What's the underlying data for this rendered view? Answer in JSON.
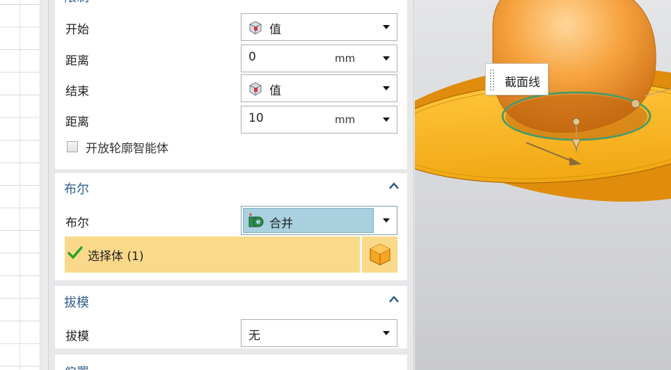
{
  "limit_section": {
    "title_partial": "限制",
    "start_label": "开始",
    "start_value": "值",
    "distance1_label": "距离",
    "distance1_value": "0",
    "distance1_unit": "mm",
    "end_label": "结束",
    "end_value": "值",
    "distance2_label": "距离",
    "distance2_value": "10",
    "distance2_unit": "mm",
    "open_profile_label": "开放轮廓智能体",
    "open_profile_checked": false
  },
  "boolean_section": {
    "title": "布尔",
    "bool_label": "布尔",
    "bool_value": "合并",
    "select_body_label": "选择体 (1)"
  },
  "draft_section": {
    "title": "拔模",
    "draft_label": "拔模",
    "draft_value": "无"
  },
  "next_section": {
    "title_partial": "偏置"
  },
  "viewport": {
    "tooltip_label": "截面线"
  },
  "icons": {
    "value_icon": "cube-value-icon",
    "unite_icon": "boolean-unite-icon",
    "check_icon": "green-check-icon",
    "body_icon": "orange-cube-icon",
    "collapse_icon": "chevron-up-icon",
    "dropdown_icon": "triangle-down-icon"
  },
  "colors": {
    "section_title": "#2f5d8f",
    "selection_highlight": "#fbd98a",
    "combo_selected": "#a8d0de",
    "part_orange": "#f4a340",
    "disc_yellow": "#f7b21e"
  }
}
